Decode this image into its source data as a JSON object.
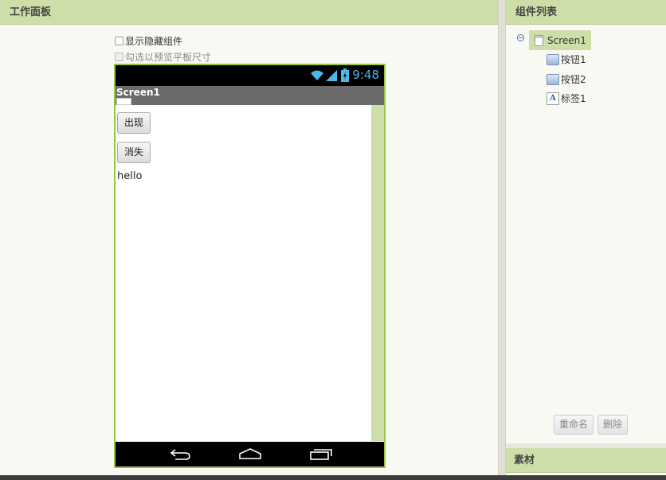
{
  "workspace": {
    "title": "工作面板",
    "show_hidden_label": "显示隐藏组件",
    "tablet_preview_label": "勾选以预览平板尺寸",
    "phone": {
      "status_time": "9:48",
      "screen_title": "Screen1",
      "button1_text": "出现",
      "button2_text": "消失",
      "label_text": "hello"
    }
  },
  "components": {
    "title": "组件列表",
    "tree": [
      {
        "label": "Screen1",
        "icon": "screen-icon"
      },
      {
        "label": "按钮1",
        "icon": "button-icon"
      },
      {
        "label": "按钮2",
        "icon": "button-icon"
      },
      {
        "label": "标签1",
        "icon": "label-icon"
      }
    ],
    "rename_label": "重命名",
    "delete_label": "删除"
  },
  "assets": {
    "title": "素材"
  },
  "colors": {
    "header_bg": "#cddea8",
    "phone_border": "#9bc33c",
    "status_accent": "#4cb8e8"
  }
}
